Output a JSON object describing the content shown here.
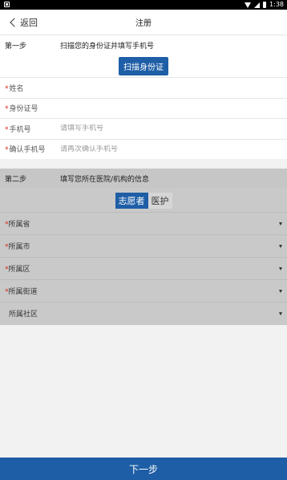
{
  "status_bar": {
    "time": "1:38"
  },
  "header": {
    "back_label": "返回",
    "title": "注册"
  },
  "step1": {
    "step_label": "第一步",
    "description": "扫描您的身份证并填写手机号",
    "scan_button": "扫描身份证",
    "fields": [
      {
        "label": "姓名",
        "required": "*",
        "value": "",
        "placeholder": ""
      },
      {
        "label": "身份证号",
        "required": "*",
        "value": "",
        "placeholder": ""
      },
      {
        "label": "手机号",
        "required": "*",
        "value": "",
        "placeholder": "请填写手机号"
      },
      {
        "label": "确认手机号",
        "required": "*",
        "value": "",
        "placeholder": "请再次确认手机号"
      }
    ]
  },
  "step2": {
    "step_label": "第二步",
    "description": "填写您所在医院/机构的信息",
    "toggle": {
      "option_volunteer": "志愿者",
      "option_medical": "医护",
      "selected": "志愿者"
    },
    "selects": [
      {
        "label": "所属省",
        "required": "*"
      },
      {
        "label": "所属市",
        "required": "*"
      },
      {
        "label": "所属区",
        "required": "*"
      },
      {
        "label": "所属街道",
        "required": "*"
      },
      {
        "label": "所属社区",
        "required": ""
      }
    ]
  },
  "footer": {
    "next_button": "下一步"
  },
  "colors": {
    "primary": "#1e5ea6",
    "required": "#d9281b",
    "overlay": "#c9c9c9"
  }
}
